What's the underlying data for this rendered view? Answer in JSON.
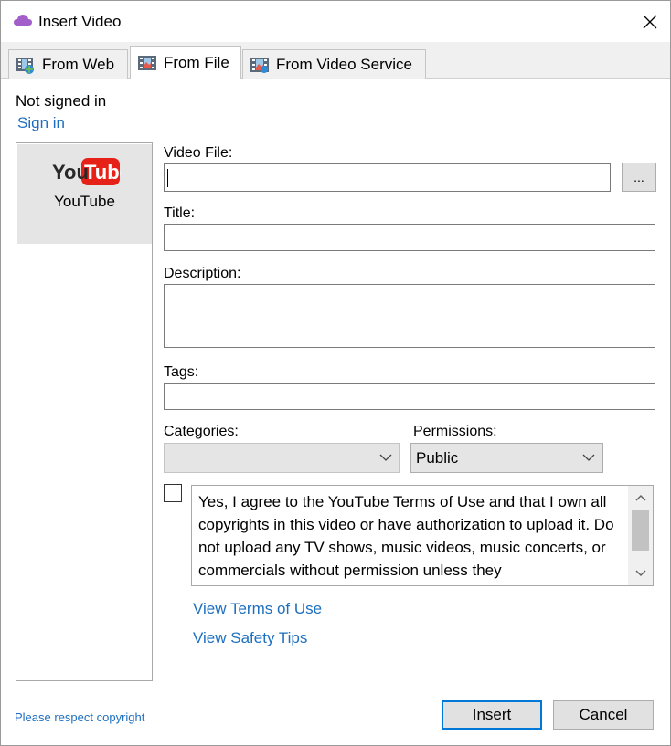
{
  "window": {
    "title": "Insert Video",
    "app_icon": "cloud-icon",
    "close_icon": "close-icon"
  },
  "tabs": [
    {
      "label": "From Web",
      "icon": "web-video-icon",
      "active": false
    },
    {
      "label": "From File",
      "icon": "file-video-icon",
      "active": true
    },
    {
      "label": "From Video Service",
      "icon": "video-service-icon",
      "active": false
    }
  ],
  "account": {
    "status": "Not signed in",
    "sign_in_label": "Sign in"
  },
  "services": [
    {
      "name": "YouTube",
      "logo_text_you": "You",
      "logo_text_tube": "Tube",
      "selected": true
    }
  ],
  "form": {
    "video_file_label": "Video File:",
    "video_file_value": "",
    "browse_label": "...",
    "title_label": "Title:",
    "title_value": "",
    "description_label": "Description:",
    "description_value": "",
    "tags_label": "Tags:",
    "tags_value": "",
    "categories_label": "Categories:",
    "categories_value": "",
    "permissions_label": "Permissions:",
    "permissions_value": "Public"
  },
  "agreement": {
    "checked": false,
    "text": "Yes, I agree to the YouTube Terms of Use and that I own all copyrights in this video or have authorization to upload it. Do not upload any TV shows, music videos, music concerts, or commercials without permission unless they"
  },
  "links": {
    "terms": "View Terms of Use",
    "safety": "View Safety Tips",
    "copyright": "Please respect copyright"
  },
  "buttons": {
    "insert": "Insert",
    "cancel": "Cancel"
  },
  "colors": {
    "link": "#1e6fbf",
    "accent": "#0078d7",
    "youtube_red": "#e62117"
  }
}
